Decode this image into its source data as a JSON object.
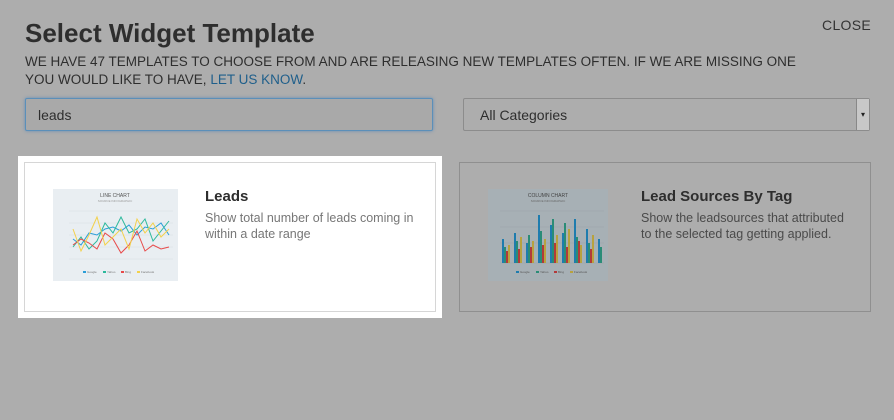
{
  "dialog": {
    "title": "Select Widget Template",
    "close_label": "CLOSE",
    "subtitle_text": "WE HAVE 47 TEMPLATES TO CHOOSE FROM AND ARE RELEASING NEW TEMPLATES OFTEN. IF WE ARE MISSING ONE YOU WOULD LIKE TO HAVE,",
    "subtitle_link": "LET US KNOW",
    "subtitle_end": "."
  },
  "search": {
    "value": "leads"
  },
  "category_select": {
    "selected": "All Categories"
  },
  "templates": [
    {
      "title": "Leads",
      "description": "Show total number of leads coming in within a date range",
      "thumbnail": {
        "chart_title": "LINE CHART",
        "chart_subtitle": "SOURCE INFOGRAPHIC",
        "legend": [
          "Google",
          "Yahoo",
          "Bing",
          "Facebook"
        ]
      }
    },
    {
      "title": "Lead Sources By Tag",
      "description": "Show the leadsources that attributed to the selected tag getting applied.",
      "thumbnail": {
        "chart_title": "COLUMN CHART",
        "chart_subtitle": "SOURCE INFOGRAPHIC",
        "legend": [
          "Google",
          "Yahoo",
          "Bing",
          "Facebook"
        ]
      }
    }
  ],
  "colors": {
    "overlay": "#adadad",
    "link": "#1f5f8b",
    "series": [
      "#2b9ed8",
      "#2cb99c",
      "#e84a4a",
      "#f3d14b"
    ]
  }
}
